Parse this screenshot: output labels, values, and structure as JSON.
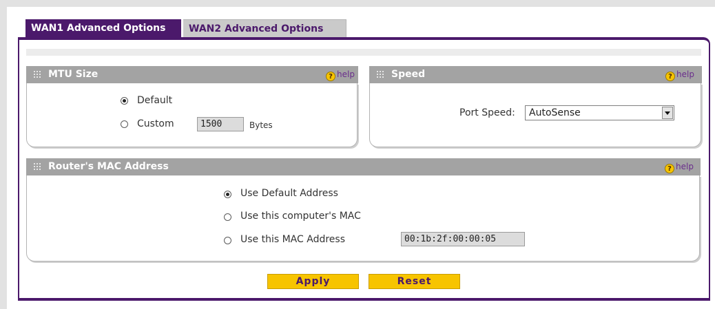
{
  "tabs": {
    "wan1": "WAN1 Advanced Options",
    "wan2": "WAN2 Advanced Options"
  },
  "help_label": "help",
  "mtu": {
    "title": "MTU Size",
    "default_label": "Default",
    "custom_label": "Custom",
    "custom_value": "1500",
    "unit": "Bytes",
    "selected": "Default"
  },
  "speed": {
    "title": "Speed",
    "port_speed_label": "Port Speed:",
    "port_speed_value": "AutoSense"
  },
  "mac": {
    "title": "Router's MAC Address",
    "opt_default": "Use Default Address",
    "opt_computer": "Use this computer's MAC",
    "opt_custom": "Use this MAC Address",
    "custom_value": "00:1b:2f:00:00:05",
    "selected": "Use Default Address"
  },
  "buttons": {
    "apply": "Apply",
    "reset": "Reset"
  },
  "colors": {
    "accent": "#4b196b",
    "button": "#f7c400",
    "section_header": "#a3a3a3"
  }
}
